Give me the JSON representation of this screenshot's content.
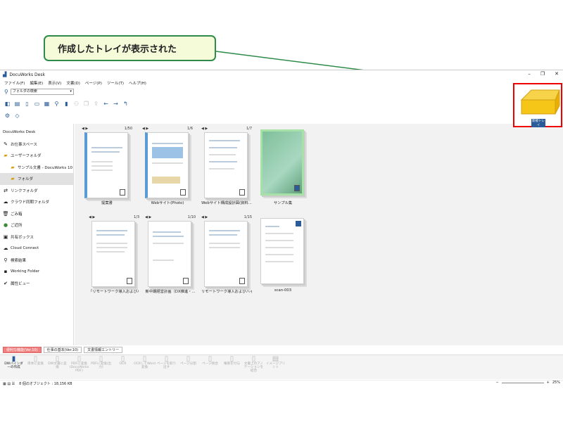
{
  "callout": {
    "text": "作成したトレイが表示された"
  },
  "colors": {
    "callout_border": "#2e8b4a",
    "callout_bg": "#f5fad9",
    "tray": "#f5c518",
    "highlight": "#e00000",
    "active_tab": "#f08080"
  },
  "app": {
    "title": "DocuWorks Desk",
    "menu": [
      "ファイル(F)",
      "編集(E)",
      "表示(V)",
      "文書(D)",
      "ページ(P)",
      "ツール(T)",
      "ヘルプ(H)"
    ],
    "search": {
      "value": "フォルダの検索"
    }
  },
  "sidebar": {
    "items": [
      {
        "label": "DocuWorks Desk",
        "icon": ""
      },
      {
        "label": "お仕事スペース",
        "icon": "workspace-icon"
      },
      {
        "label": "ユーザーフォルダ",
        "icon": "folder-icon"
      },
      {
        "label": "サンプル文書 - DocuWorks 10",
        "icon": "folder-icon"
      },
      {
        "label": "フォルダ",
        "icon": "folder-icon"
      },
      {
        "label": "リンクフォルダ",
        "icon": "link-folder-icon"
      },
      {
        "label": "クラウド同期フォルダ",
        "icon": "cloud-icon"
      },
      {
        "label": "ごみ箱",
        "icon": "trash-icon"
      },
      {
        "label": "ご近所",
        "icon": "neighbor-icon"
      },
      {
        "label": "共有ボックス",
        "icon": "share-box-icon"
      },
      {
        "label": "Cloud Connect",
        "icon": "cloud-connect-icon"
      },
      {
        "label": "検索結果",
        "icon": "search-icon"
      },
      {
        "label": "Working Folder",
        "icon": "working-folder-icon"
      },
      {
        "label": "属性ビュー",
        "icon": "attribute-icon"
      }
    ]
  },
  "documents": [
    {
      "caption": "提案書",
      "pages": "1/50"
    },
    {
      "caption": "Webサイト(Photo)",
      "pages": "1/6"
    },
    {
      "caption": "Webサイト構成設計図(資料...",
      "pages": "1/7"
    },
    {
      "caption": "サンプル集",
      "pages": ""
    },
    {
      "caption": "「リモートワーク導入およびハイ...",
      "pages": "1/3"
    },
    {
      "caption": "新中期経営計画（DX推進・...",
      "pages": "1/10"
    },
    {
      "caption": "リモートワーク導入およびハイブ...",
      "pages": "1/15"
    },
    {
      "caption": "scan-003",
      "pages": ""
    }
  ],
  "bottom_tabs": [
    "便利な機能(Ver.10)",
    "仕事の基本(Ver.10)",
    "文書情報エントリー"
  ],
  "bottom_actions": [
    "DWバインダーの作成",
    "単体に変換",
    "DW文書に変換",
    "PDFに変換(DocuWorks PDF)",
    "PDFに変換(出力)",
    "OCR",
    "OCRしてWord変換",
    "ページを取り出す",
    "ページ分割",
    "ページ統合",
    "権限を付与",
    "文書上のアノテーションを結合",
    "イメージプリント"
  ],
  "status": {
    "objects": "8 個のオブジェクト : 18,156 KB",
    "zoom": "25%"
  },
  "tray": {
    "label": "新規トレイ"
  }
}
